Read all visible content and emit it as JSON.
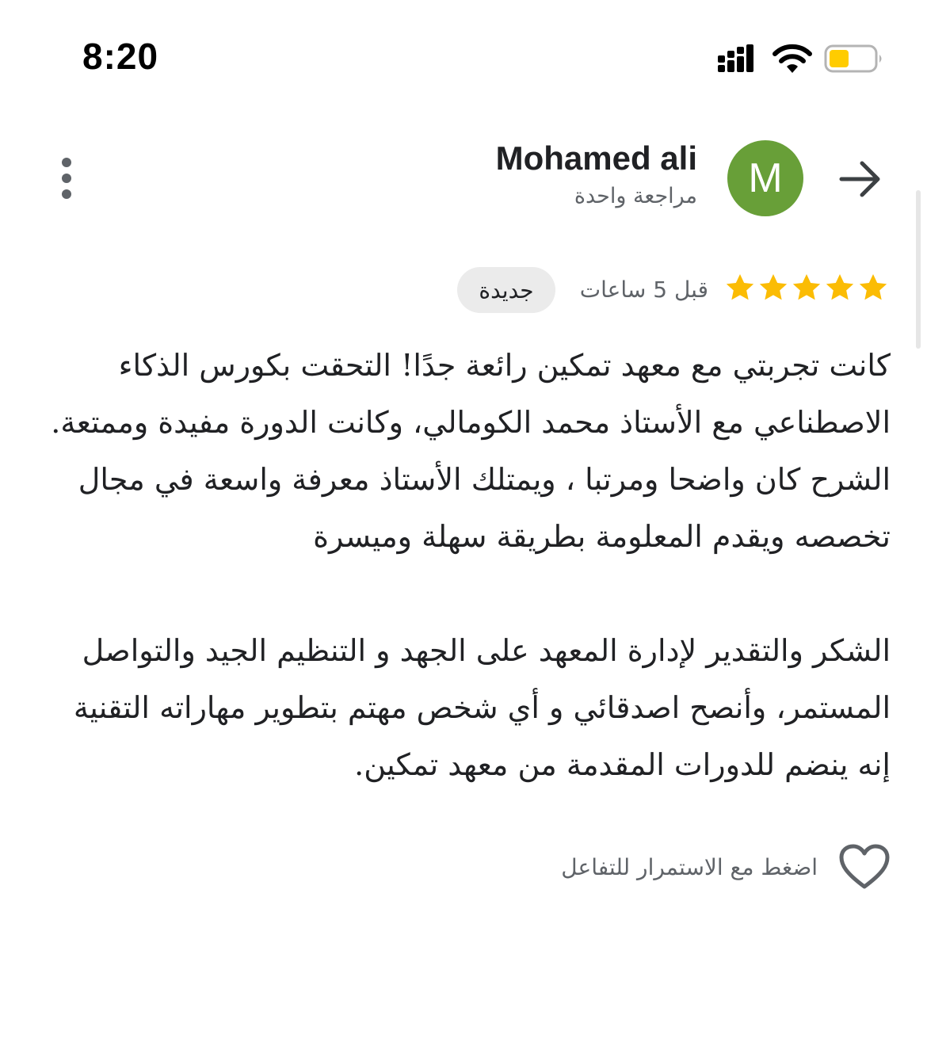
{
  "status_bar": {
    "time": "8:20",
    "signal_icon": "cellular-signal-icon",
    "wifi_icon": "wifi-icon",
    "battery_icon": "battery-icon",
    "battery_color": "#ffcc00"
  },
  "header": {
    "author_name": "Mohamed ali",
    "author_subtitle": "مراجعة واحدة",
    "avatar_letter": "M",
    "avatar_color": "#689f38",
    "back_icon": "arrow-icon",
    "menu_icon": "more-vertical-icon"
  },
  "rating": {
    "stars": 5,
    "max_stars": 5,
    "star_color": "#fbbc04",
    "time_ago": "قبل 5 ساعات",
    "badge": "جديدة"
  },
  "review": {
    "paragraph_1": "كانت تجربتي مع معهد تمكين رائعة جدًا! التحقت بكورس الذكاء الاصطناعي مع الأستاذ محمد الكومالي، وكانت الدورة مفيدة وممتعة. الشرح كان واضحا ومرتبا ، ويمتلك الأستاذ معرفة واسعة في مجال تخصصه ويقدم المعلومة بطريقة سهلة وميسرة",
    "paragraph_2": "الشكر والتقدير لإدارة المعهد على الجهد و التنظيم الجيد والتواصل المستمر، وأنصح اصدقائي و أي شخص مهتم بتطوير مهاراته التقنية إنه ينضم للدورات المقدمة من معهد تمكين."
  },
  "footer": {
    "like_label": "اضغط مع الاستمرار للتفاعل",
    "like_icon": "heart-icon"
  }
}
